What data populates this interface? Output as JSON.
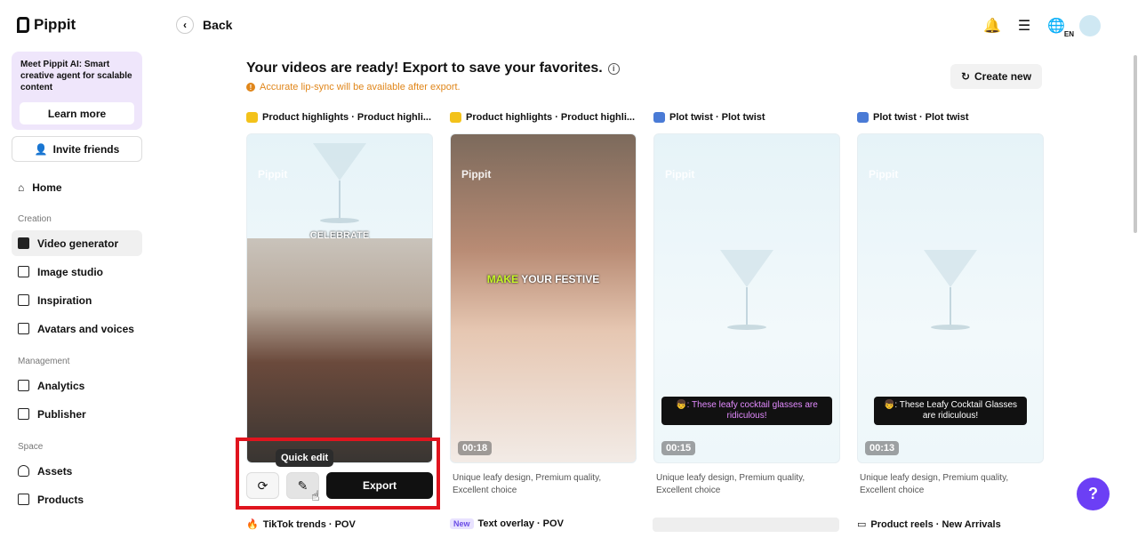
{
  "app": {
    "name": "Pippit"
  },
  "sidebar": {
    "promo": {
      "text": "Meet Pippit AI: Smart creative agent for scalable content",
      "button": "Learn more"
    },
    "invite": "Invite friends",
    "home": "Home",
    "sections": {
      "creation": "Creation",
      "management": "Management",
      "space": "Space"
    },
    "items": {
      "video_generator": "Video generator",
      "image_studio": "Image studio",
      "inspiration": "Inspiration",
      "avatars": "Avatars and voices",
      "analytics": "Analytics",
      "publisher": "Publisher",
      "assets": "Assets",
      "products": "Products"
    }
  },
  "topbar": {
    "back": "Back",
    "lang": "EN"
  },
  "main": {
    "headline": "Your videos are ready! Export to save your favorites.",
    "warning": "Accurate lip-sync will be available after export.",
    "create_new": "Create new",
    "cards": [
      {
        "title": "Product highlights · Product highli...",
        "watermark": "Pippit",
        "overlay": "CELEBRATE",
        "duration": "",
        "desc": ""
      },
      {
        "title": "Product highlights · Product highli...",
        "watermark": "Pippit",
        "overlay_a": "MAKE",
        "overlay_b": "YOUR FESTIVE",
        "duration": "00:18",
        "desc": "Unique leafy design, Premium quality, Excellent choice"
      },
      {
        "title": "Plot twist · Plot twist",
        "watermark": "Pippit",
        "caption": "👦: These leafy cocktail glasses are ridiculous!",
        "duration": "00:15",
        "desc": "Unique leafy design, Premium quality, Excellent choice"
      },
      {
        "title": "Plot twist · Plot twist",
        "watermark": "Pippit",
        "caption": "👦: These Leafy Cocktail Glasses are ridiculous!",
        "duration": "00:13",
        "desc": "Unique leafy design, Premium quality, Excellent choice"
      }
    ],
    "actions": {
      "tooltip": "Quick edit",
      "export": "Export"
    },
    "row2": {
      "c1": "TikTok trends · POV",
      "c2_badge": "New",
      "c2": "Text overlay · POV",
      "c4": "Product reels · New Arrivals"
    }
  },
  "help": "?",
  "colors": {
    "accent": "#6c3ff5",
    "warning": "#e0861a",
    "highlight": "#e0141e"
  }
}
